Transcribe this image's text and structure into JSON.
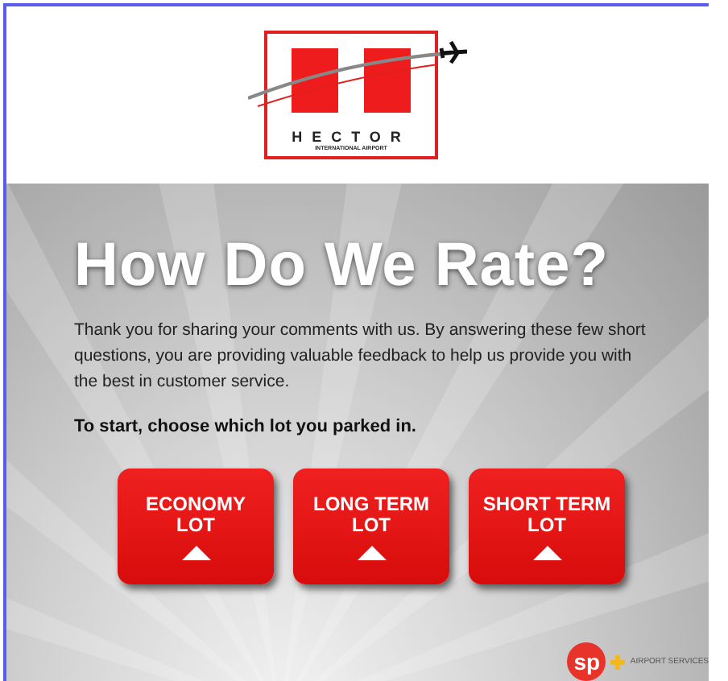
{
  "logo": {
    "name": "HECTOR",
    "subtitle": "INTERNATIONAL AIRPORT"
  },
  "title": "How Do We Rate?",
  "intro": "Thank you for sharing your comments with us. By answering these few short questions, you are providing valuable feedback to help us provide you with the best in customer service.",
  "prompt": "To start, choose which lot you parked in.",
  "lots": [
    {
      "label": "ECONOMY LOT"
    },
    {
      "label": "LONG TERM LOT"
    },
    {
      "label": "SHORT TERM LOT"
    }
  ],
  "footer_logo": {
    "mark": "sp",
    "text": "AIRPORT SERVICES"
  }
}
